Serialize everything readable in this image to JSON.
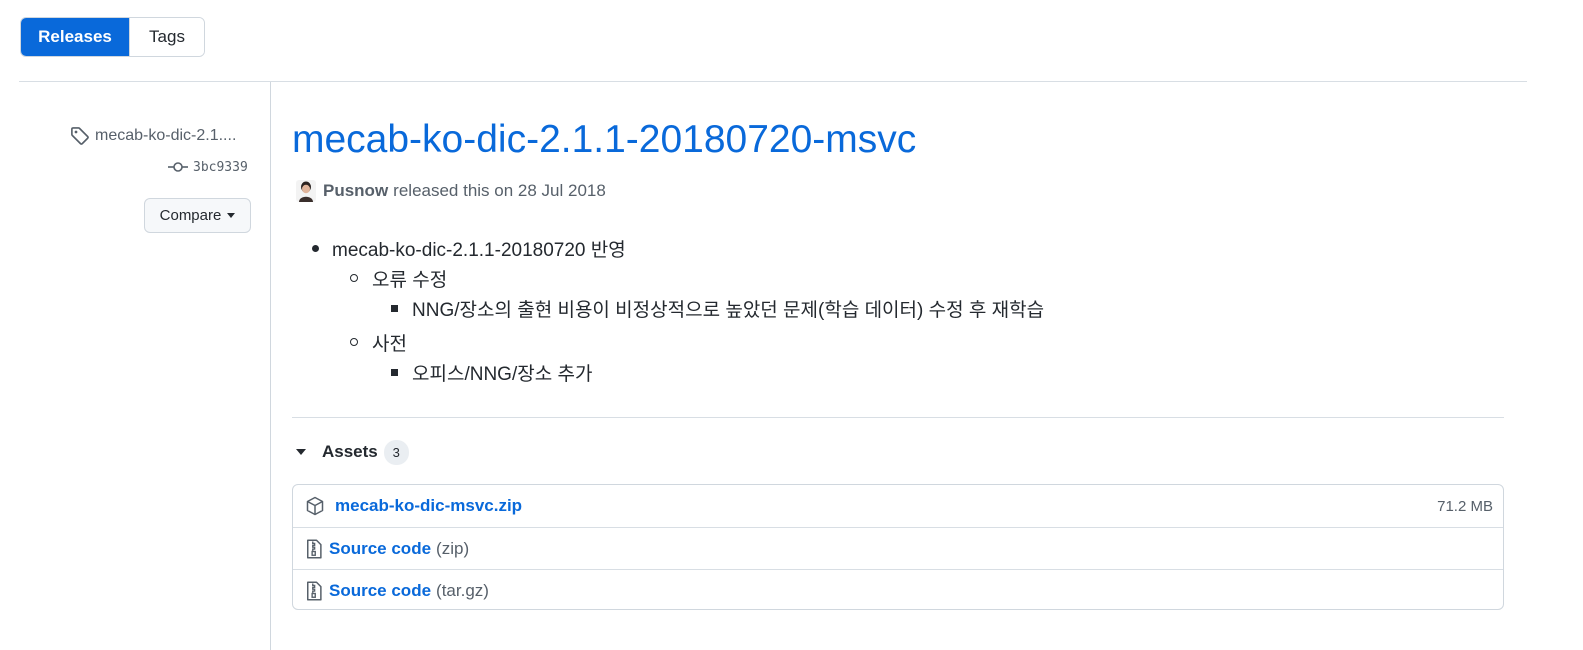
{
  "tabs": [
    {
      "label": "Releases",
      "active": true
    },
    {
      "label": "Tags",
      "active": false
    }
  ],
  "sidebar": {
    "tag_label": "mecab-ko-dic-2.1....",
    "commit": "3bc9339",
    "compare_label": "Compare"
  },
  "release": {
    "title": "mecab-ko-dic-2.1.1-20180720-msvc",
    "author": "Pusnow",
    "released_text": "released this on 28 Jul 2018",
    "notes": {
      "item1": "mecab-ko-dic-2.1.1-20180720 반영",
      "sub1": "오류 수정",
      "sub1_item": "NNG/장소의 출현 비용이 비정상적으로 높았던 문제(학습 데이터) 수정 후 재학습",
      "sub2": "사전",
      "sub2_item": "오피스/NNG/장소 추가"
    }
  },
  "assets": {
    "heading": "Assets",
    "count": "3",
    "items": [
      {
        "name": "mecab-ko-dic-msvc.zip",
        "suffix": "",
        "size": "71.2 MB",
        "icon": "package-icon"
      },
      {
        "name": "Source code",
        "suffix": "(zip)",
        "size": "",
        "icon": "file-zip-icon"
      },
      {
        "name": "Source code",
        "suffix": "(tar.gz)",
        "size": "",
        "icon": "file-zip-icon"
      }
    ]
  },
  "colors": {
    "accent": "#0969da",
    "muted": "#57606a",
    "border": "#d0d7de"
  }
}
